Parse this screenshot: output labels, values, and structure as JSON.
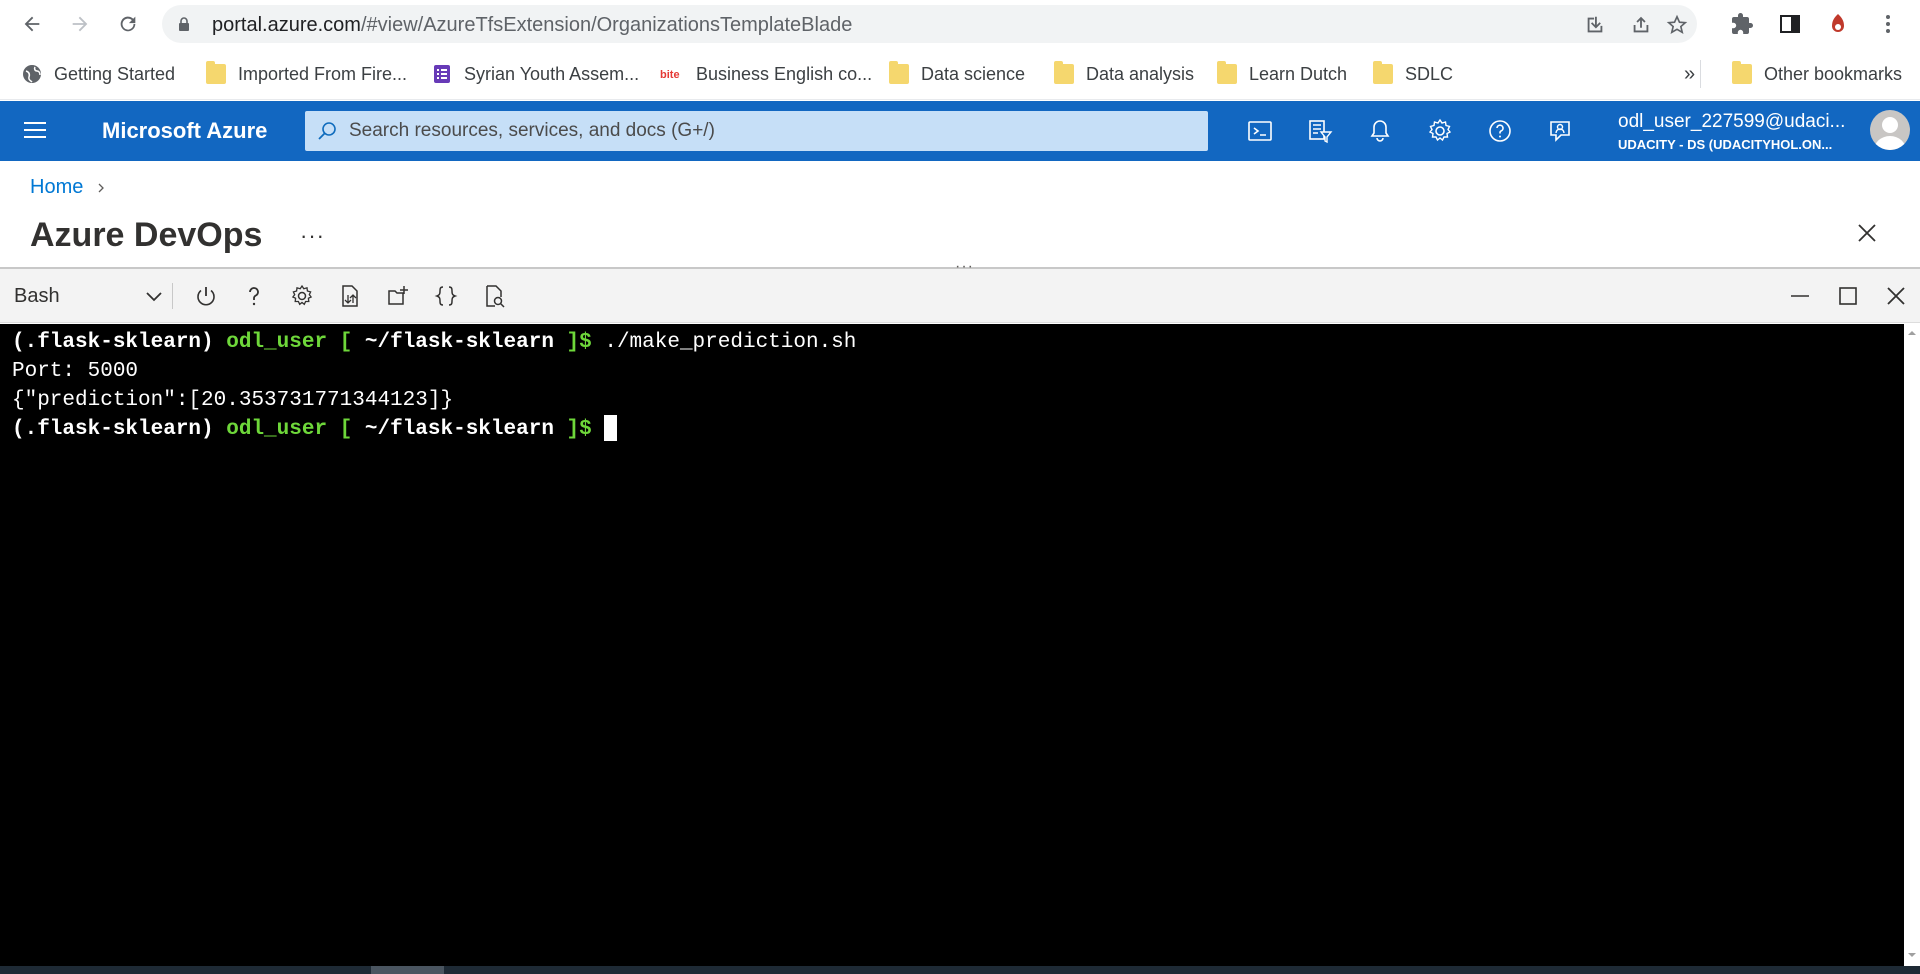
{
  "browser": {
    "url_host": "portal.azure.com",
    "url_path": "/#view/AzureTfsExtension/OrganizationsTemplateBlade"
  },
  "bookmarks": {
    "items": [
      {
        "label": "Getting Started",
        "icon": "globe-icon"
      },
      {
        "label": "Imported From Fire...",
        "icon": "folder-icon"
      },
      {
        "label": "Syrian Youth Assem...",
        "icon": "forms-icon"
      },
      {
        "label": "Business English co...",
        "icon": "bite-icon"
      },
      {
        "label": "Data science",
        "icon": "folder-icon"
      },
      {
        "label": "Data analysis",
        "icon": "folder-icon"
      },
      {
        "label": "Learn Dutch",
        "icon": "folder-icon"
      },
      {
        "label": "SDLC",
        "icon": "folder-icon"
      }
    ],
    "overflow": "»",
    "other": "Other bookmarks"
  },
  "azure": {
    "title": "Microsoft Azure",
    "search_placeholder": "Search resources, services, and docs (G+/)",
    "account_user": "odl_user_227599@udaci...",
    "account_directory": "UDACITY - DS (UDACITYHOL.ON..."
  },
  "blade": {
    "breadcrumb_home": "Home",
    "title": "Azure DevOps",
    "more": "···"
  },
  "shell": {
    "splitter": "···",
    "type": "Bash",
    "lines": [
      {
        "prefix": "(.flask-sklearn) ",
        "user": "odl_user",
        "bracket_open": " [ ",
        "path": "~/flask-sklearn",
        "bracket_close": " ]$ ",
        "command": "./make_prediction.sh"
      },
      {
        "text": "Port: 5000"
      },
      {
        "text": "{\"prediction\":[20.353731771344123]}"
      },
      {
        "prefix": "(.flask-sklearn) ",
        "user": "odl_user",
        "bracket_open": " [ ",
        "path": "~/flask-sklearn",
        "bracket_close": " ]$ ",
        "command": ""
      }
    ]
  },
  "colors": {
    "azure_blue": "#1267c1",
    "terminal_bg": "#000000",
    "prompt_green": "#6ed73a"
  }
}
